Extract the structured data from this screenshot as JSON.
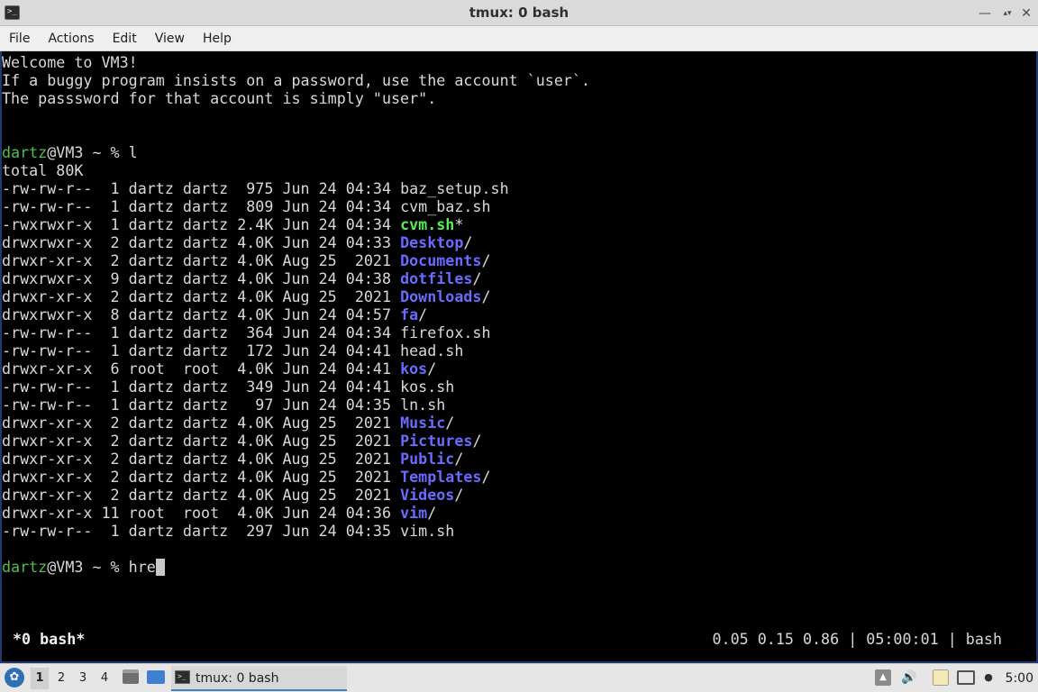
{
  "window": {
    "title": "tmux: 0 bash",
    "icon": "terminal-icon",
    "buttons": [
      "minimize",
      "maximize",
      "close"
    ]
  },
  "menu": [
    "File",
    "Actions",
    "Edit",
    "View",
    "Help"
  ],
  "terminal": {
    "motd": [
      "Welcome to VM3!",
      "If a buggy program insists on a password, use the account `user`.",
      "The passsword for that account is simply \"user\"."
    ],
    "prompt_user": "dartz",
    "prompt_rest": "@VM3 ~ % ",
    "command1": "l",
    "total": "total 80K",
    "listing": [
      {
        "meta": "-rw-rw-r--  1 dartz dartz  975 Jun 24 04:34 ",
        "name": "baz_setup.sh",
        "type": "file",
        "suffix": ""
      },
      {
        "meta": "-rw-rw-r--  1 dartz dartz  809 Jun 24 04:34 ",
        "name": "cvm_baz.sh",
        "type": "file",
        "suffix": ""
      },
      {
        "meta": "-rwxrwxr-x  1 dartz dartz 2.4K Jun 24 04:34 ",
        "name": "cvm.sh",
        "type": "exe",
        "suffix": "*"
      },
      {
        "meta": "drwxrwxr-x  2 dartz dartz 4.0K Jun 24 04:33 ",
        "name": "Desktop",
        "type": "dir",
        "suffix": "/"
      },
      {
        "meta": "drwxr-xr-x  2 dartz dartz 4.0K Aug 25  2021 ",
        "name": "Documents",
        "type": "dir",
        "suffix": "/"
      },
      {
        "meta": "drwxrwxr-x  9 dartz dartz 4.0K Jun 24 04:38 ",
        "name": "dotfiles",
        "type": "dir",
        "suffix": "/"
      },
      {
        "meta": "drwxr-xr-x  2 dartz dartz 4.0K Aug 25  2021 ",
        "name": "Downloads",
        "type": "dir",
        "suffix": "/"
      },
      {
        "meta": "drwxrwxr-x  8 dartz dartz 4.0K Jun 24 04:57 ",
        "name": "fa",
        "type": "dir",
        "suffix": "/"
      },
      {
        "meta": "-rw-rw-r--  1 dartz dartz  364 Jun 24 04:34 ",
        "name": "firefox.sh",
        "type": "file",
        "suffix": ""
      },
      {
        "meta": "-rw-rw-r--  1 dartz dartz  172 Jun 24 04:41 ",
        "name": "head.sh",
        "type": "file",
        "suffix": ""
      },
      {
        "meta": "drwxr-xr-x  6 root  root  4.0K Jun 24 04:41 ",
        "name": "kos",
        "type": "dir",
        "suffix": "/"
      },
      {
        "meta": "-rw-rw-r--  1 dartz dartz  349 Jun 24 04:41 ",
        "name": "kos.sh",
        "type": "file",
        "suffix": ""
      },
      {
        "meta": "-rw-rw-r--  1 dartz dartz   97 Jun 24 04:35 ",
        "name": "ln.sh",
        "type": "file",
        "suffix": ""
      },
      {
        "meta": "drwxr-xr-x  2 dartz dartz 4.0K Aug 25  2021 ",
        "name": "Music",
        "type": "dir",
        "suffix": "/"
      },
      {
        "meta": "drwxr-xr-x  2 dartz dartz 4.0K Aug 25  2021 ",
        "name": "Pictures",
        "type": "dir",
        "suffix": "/"
      },
      {
        "meta": "drwxr-xr-x  2 dartz dartz 4.0K Aug 25  2021 ",
        "name": "Public",
        "type": "dir",
        "suffix": "/"
      },
      {
        "meta": "drwxr-xr-x  2 dartz dartz 4.0K Aug 25  2021 ",
        "name": "Templates",
        "type": "dir",
        "suffix": "/"
      },
      {
        "meta": "drwxr-xr-x  2 dartz dartz 4.0K Aug 25  2021 ",
        "name": "Videos",
        "type": "dir",
        "suffix": "/"
      },
      {
        "meta": "drwxr-xr-x 11 root  root  4.0K Jun 24 04:36 ",
        "name": "vim",
        "type": "dir",
        "suffix": "/"
      },
      {
        "meta": "-rw-rw-r--  1 dartz dartz  297 Jun 24 04:35 ",
        "name": "vim.sh",
        "type": "file",
        "suffix": ""
      }
    ],
    "command2": "hre"
  },
  "tmux_status": {
    "left": "*0 bash*",
    "right": "0.05 0.15 0.86 | 05:00:01 | bash"
  },
  "taskbar": {
    "workspaces": [
      "1",
      "2",
      "3",
      "4"
    ],
    "active_workspace": "1",
    "task_label": "tmux: 0 bash",
    "clock": "5:00"
  },
  "colors": {
    "directory": "#6a6aff",
    "executable": "#55ee55",
    "prompt_user": "#4dbe4d",
    "accent": "#3f7fd0"
  }
}
